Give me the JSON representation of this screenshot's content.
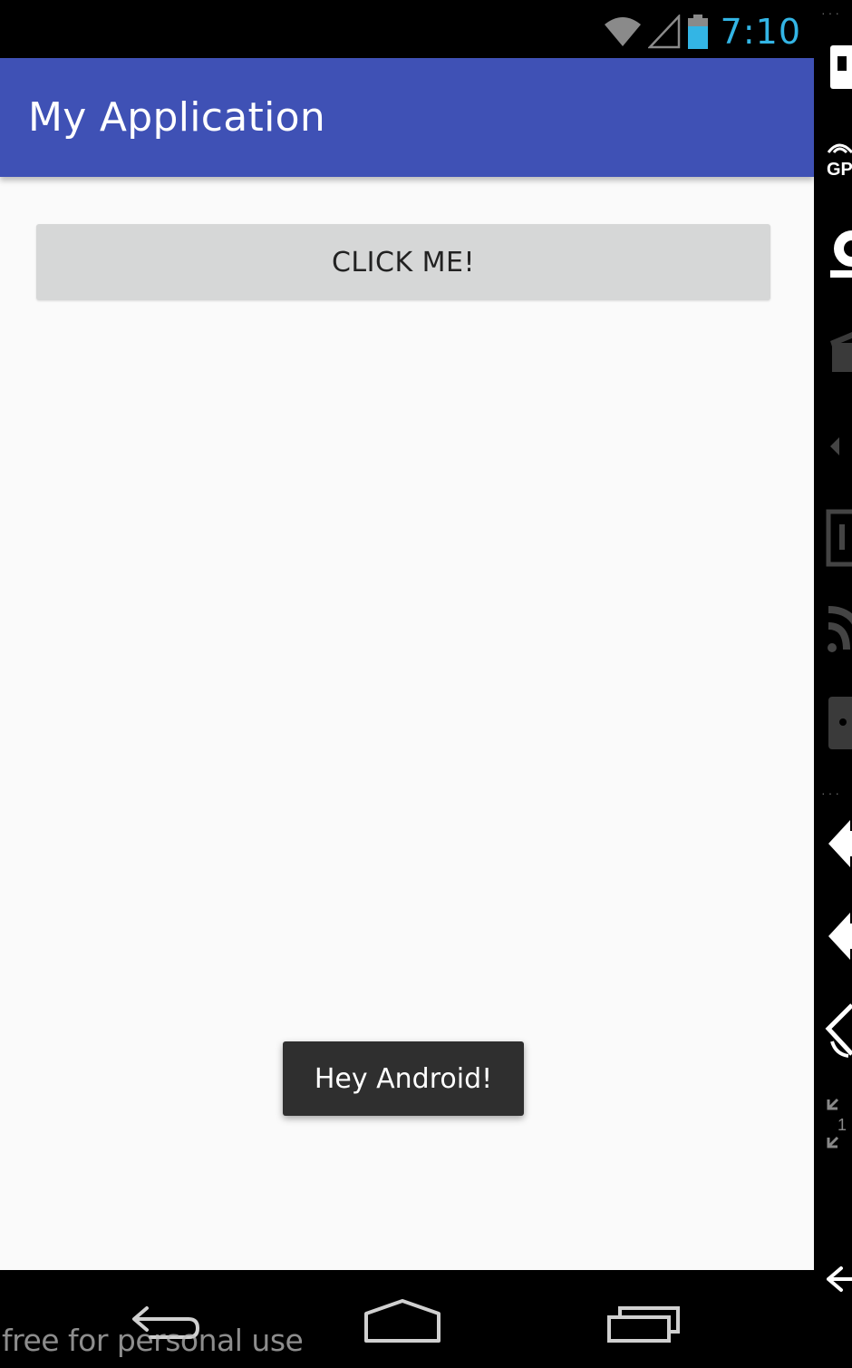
{
  "status_bar": {
    "time": "7:10",
    "icons": [
      "wifi-icon",
      "cell-signal-icon",
      "battery-icon"
    ],
    "time_color": "#33b5e5"
  },
  "app_bar": {
    "title": "My Application",
    "color": "#3f51b5"
  },
  "main": {
    "button_label": "CLICK ME!",
    "toast_text": "Hey Android!"
  },
  "nav_bar": {
    "buttons": [
      "back-icon",
      "home-icon",
      "recents-icon"
    ]
  },
  "watermark": "free for personal use",
  "side_toolbar": {
    "items": [
      "power-icon",
      "gps-icon",
      "camera-icon",
      "clapperboard-icon",
      "volume-down-icon",
      "slider-icon",
      "rss-icon",
      "rotate-icon",
      "volume-up-icon",
      "volume-down-2-icon",
      "orientation-icon",
      "scale-icon",
      "back-arrow-icon"
    ],
    "gps_label": "GP",
    "scale_label": "1"
  }
}
